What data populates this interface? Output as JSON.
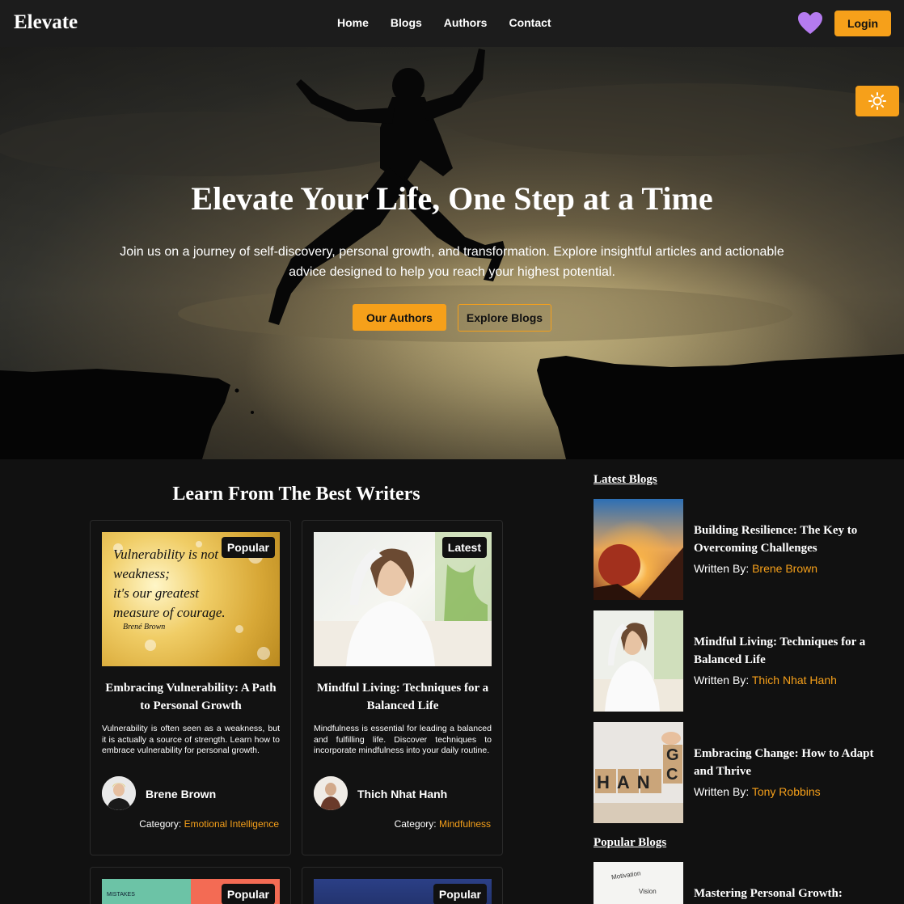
{
  "brand": "Elevate",
  "nav": {
    "items": [
      {
        "label": "Home"
      },
      {
        "label": "Blogs"
      },
      {
        "label": "Authors"
      },
      {
        "label": "Contact"
      }
    ],
    "login_label": "Login"
  },
  "hero": {
    "title": "Elevate Your Life, One Step at a Time",
    "subtitle": "Join us on a journey of self-discovery, personal growth, and transformation. Explore insightful articles and actionable advice designed to help you reach your highest potential.",
    "primary_button": "Our Authors",
    "secondary_button": "Explore Blogs"
  },
  "icons": {
    "favorite": "heart-icon",
    "theme_toggle": "sun-icon"
  },
  "colors": {
    "accent": "#f6a01a",
    "heart": "#b57bf0",
    "background": "#111111",
    "nav_background": "#1c1c1c"
  },
  "main": {
    "section_title": "Learn From The Best Writers",
    "cards": [
      {
        "badge": "Popular",
        "image_quote_lines": [
          "Vulnerability is not",
          "weakness;",
          "it's our greatest",
          "measure of courage.",
          "Brené Brown"
        ],
        "title": "Embracing Vulnerability: A Path to Personal Growth",
        "description": "Vulnerability is often seen as a weakness, but it is actually a source of strength. Learn how to embrace vulnerability for personal growth.",
        "author": "Brene Brown",
        "category_label": "Category:",
        "category": "Emotional Intelligence"
      },
      {
        "badge": "Latest",
        "title": "Mindful Living: Techniques for a Balanced Life",
        "description": "Mindfulness is essential for leading a balanced and fulfilling life. Discover techniques to incorporate mindfulness into your daily routine.",
        "author": "Thich Nhat Hanh",
        "category_label": "Category:",
        "category": "Mindfulness"
      },
      {
        "badge": "Popular",
        "image_text": "MISTAKES"
      },
      {
        "badge": "Popular"
      }
    ]
  },
  "sidebar": {
    "latest_heading": "Latest Blogs",
    "popular_heading": "Popular Blogs",
    "written_by_label": "Written By:",
    "latest": [
      {
        "title": "Building Resilience: The Key to Overcoming Challenges",
        "author": "Brene Brown"
      },
      {
        "title": "Mindful Living: Techniques for a Balanced Life",
        "author": "Thich Nhat Hanh"
      },
      {
        "title": "Embracing Change: How to Adapt and Thrive",
        "author": "Tony Robbins",
        "image_letters": "HAN",
        "image_letters_top": "G",
        "image_letters_side": "C"
      }
    ],
    "popular": [
      {
        "title": "Mastering Personal Growth:",
        "image_words": [
          "Motivation",
          "Vision"
        ]
      }
    ]
  }
}
